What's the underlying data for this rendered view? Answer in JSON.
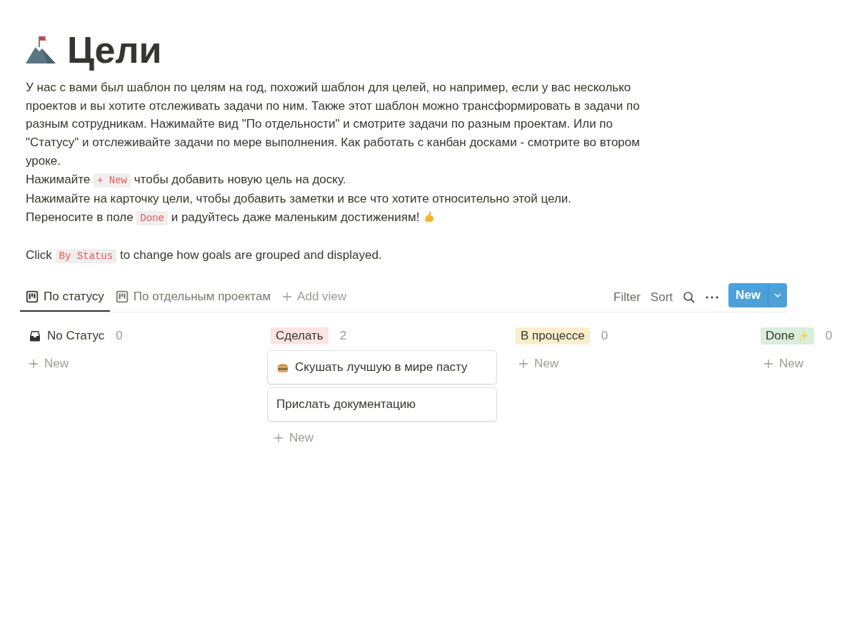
{
  "page": {
    "title": "Цели"
  },
  "description": [
    [
      {
        "kind": "text",
        "text": "У нас с вами был шаблон по целям на год, похожий шаблон для целей, но например, если у вас несколько проектов и вы хотите отслеживать задачи по ним. Также этот шаблон можно трансформировать в задачи по разным сотрудникам. Нажимайте вид \"По отдельности\" и смотрите задачи по разным проектам. Или по \"Статусу\" и отслеживайте задачи по мере выполнения. Как работать с канбан досками - смотрите во втором уроке."
      }
    ],
    [
      {
        "kind": "text",
        "text": "Нажимайте "
      },
      {
        "kind": "code",
        "text": "+ New"
      },
      {
        "kind": "text",
        "text": " чтобы добавить новую цель на доску."
      }
    ],
    [
      {
        "kind": "text",
        "text": "Нажимайте на карточку цели, чтобы добавить заметки и все что хотите относительно этой цели."
      }
    ],
    [
      {
        "kind": "text",
        "text": "Переносите в поле "
      },
      {
        "kind": "code",
        "text": "Done"
      },
      {
        "kind": "text",
        "text": " и радуйтесь даже маленьким достижениям! "
      },
      {
        "kind": "arm"
      }
    ],
    [
      {
        "kind": "spacer"
      }
    ],
    [
      {
        "kind": "text",
        "text": "Click "
      },
      {
        "kind": "code",
        "text": "By Status"
      },
      {
        "kind": "text",
        "text": " to change how goals are grouped and displayed."
      }
    ]
  ],
  "views": {
    "tabs": [
      {
        "label": "По статусу",
        "selected": true
      },
      {
        "label": "По отдельным проектам",
        "selected": false
      }
    ],
    "add_view": "Add view",
    "filter": "Filter",
    "sort": "Sort",
    "new_button": "New"
  },
  "board": {
    "columns": [
      {
        "kind": "plain",
        "label": "No Статус",
        "count": "0",
        "new_label": "New"
      },
      {
        "kind": "tag",
        "label": "Сделать",
        "color": "#fbe4e4",
        "count": "2",
        "new_label": "New",
        "cards": [
          {
            "kind": "burger",
            "title": "Скушать лучшую в мире пасту"
          },
          {
            "kind": "plain",
            "title": "Прислать документацию"
          }
        ]
      },
      {
        "kind": "tag",
        "label": "В процессе",
        "color": "#fbeecc",
        "count": "0",
        "new_label": "New"
      },
      {
        "kind": "tag-sparkle",
        "label": "Done",
        "color": "#dbeddb",
        "count": "0",
        "new_label": "New"
      }
    ]
  }
}
